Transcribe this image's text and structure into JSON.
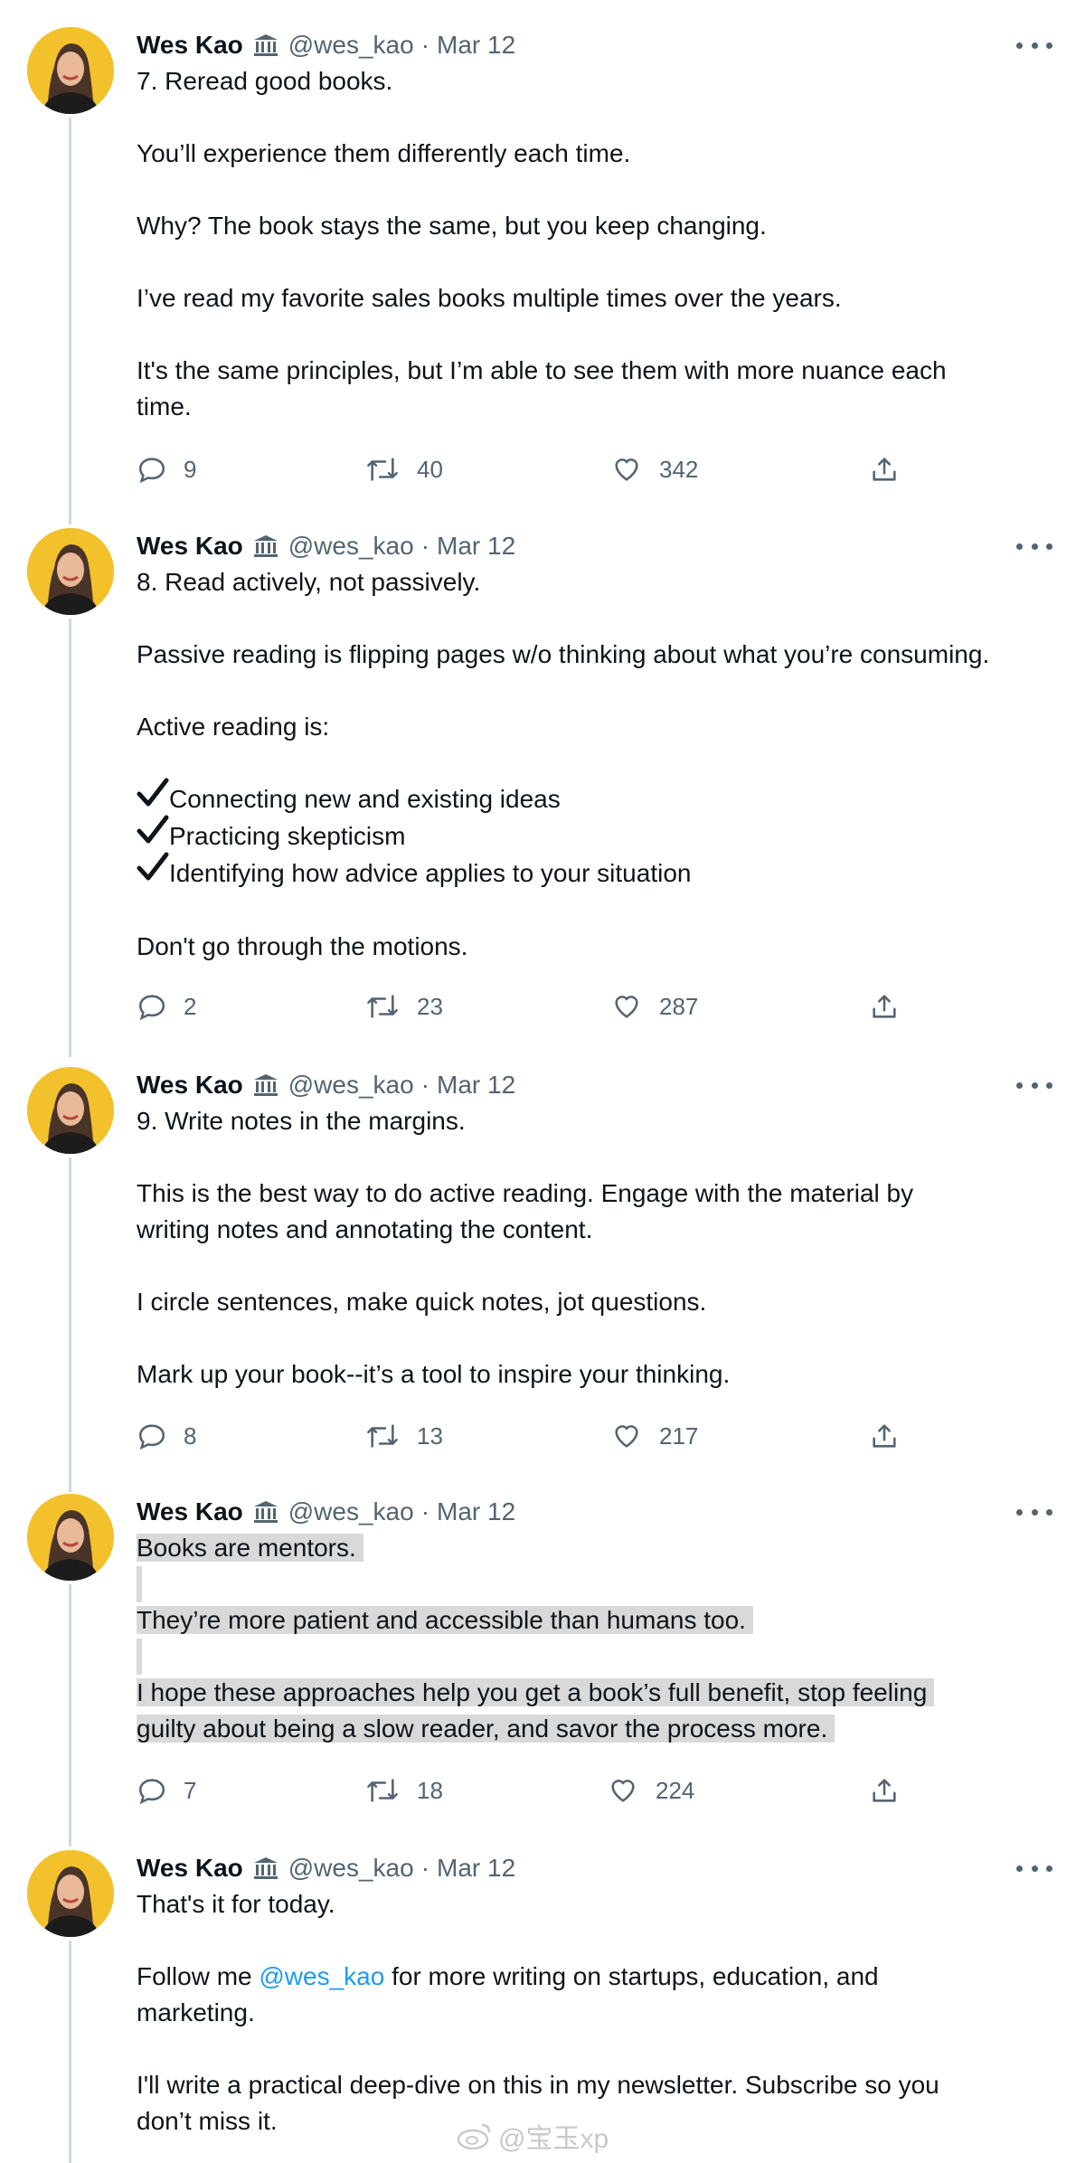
{
  "tweets": [
    {
      "name": "Wes Kao",
      "handle": "@wes_kao",
      "sep": "·",
      "date": "Mar 12",
      "paragraphs": [
        [
          "7. Reread good books."
        ],
        [
          "You’ll experience them differently each time."
        ],
        [
          "Why? The book stays the same, but you keep changing."
        ],
        [
          "I’ve read my favorite sales books multiple times over the years."
        ],
        [
          "It's the same principles, but I’m able to see them with more nuance each",
          "time."
        ]
      ],
      "stats": {
        "replies": "9",
        "retweets": "40",
        "likes": "342"
      }
    },
    {
      "name": "Wes Kao",
      "handle": "@wes_kao",
      "sep": "·",
      "date": "Mar 12",
      "intro": "8. Read actively, not passively.",
      "p2": "Passive reading is flipping pages w/o thinking about what you’re consuming.",
      "p3": "Active reading is:",
      "checklist": [
        "Connecting new and existing ideas",
        "Practicing skepticism",
        "Identifying how advice applies to your situation"
      ],
      "outro": "Don't go through the motions.",
      "stats": {
        "replies": "2",
        "retweets": "23",
        "likes": "287"
      }
    },
    {
      "name": "Wes Kao",
      "handle": "@wes_kao",
      "sep": "·",
      "date": "Mar 12",
      "p1": "9. Write notes in the margins.",
      "p2a": "This is the best way to do active reading. Engage with the material by",
      "p2b": "writing notes and annotating the content.",
      "p3": "I circle sentences, make quick notes, jot questions.",
      "p4": "Mark up your book--it’s a tool to inspire your thinking.",
      "stats": {
        "replies": "8",
        "retweets": "13",
        "likes": "217"
      }
    },
    {
      "name": "Wes Kao",
      "handle": "@wes_kao",
      "sep": "·",
      "date": "Mar 12",
      "p1": "Books are mentors.",
      "p2": "They’re more patient and accessible than humans too.",
      "p3a": "I hope these approaches help you get a book’s full benefit, stop feeling",
      "p3b": "guilty about being a slow reader, and savor the process more.",
      "stats": {
        "replies": "7",
        "retweets": "18",
        "likes": "224"
      }
    },
    {
      "name": "Wes Kao",
      "handle": "@wes_kao",
      "sep": "·",
      "date": "Mar 12",
      "p1": "That's it for today.",
      "p2_pre": "Follow me ",
      "p2_mention": "@wes_kao",
      "p2_post": " for more writing on startups, education, and",
      "p2b": "marketing.",
      "p3a": "I'll write a practical deep-dive on this in my newsletter. Subscribe so you",
      "p3b": "don’t miss it."
    }
  ],
  "watermark": "@宝玉xp",
  "colors": {
    "text": "#0f1419",
    "muted": "#536471",
    "link": "#1d9bf0",
    "line": "#cfd9de",
    "highlight": "#d9d9d9",
    "avatar_bg": "#f3c12b"
  }
}
